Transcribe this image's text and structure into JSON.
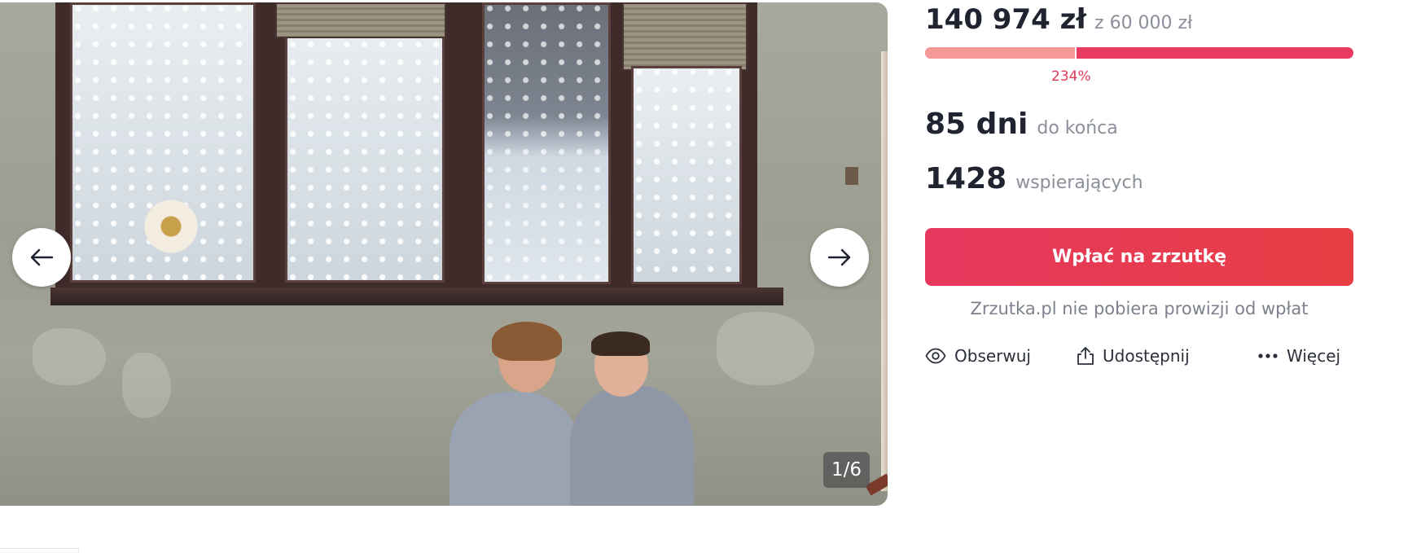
{
  "gallery": {
    "counter": "1/6",
    "prev_icon": "arrow-left-icon",
    "next_icon": "arrow-right-icon"
  },
  "fundraiser": {
    "raised": "140 974 zł",
    "goal": "z 60 000 zł",
    "progress_fraction": 0.35,
    "percent_label": "234%",
    "days_value": "85 dni",
    "days_label": "do końca",
    "supporters_value": "1428",
    "supporters_label": "wspierających",
    "cta_label": "Wpłać na zrzutkę",
    "note": "Zrzutka.pl nie pobiera prowizji od wpłat"
  },
  "actions": [
    {
      "label": "Obserwuj",
      "icon": "eye-icon"
    },
    {
      "label": "Udostępnij",
      "icon": "share-icon"
    },
    {
      "label": "Więcej",
      "icon": "more-dots-icon"
    }
  ],
  "colors": {
    "accent": "#e5395f",
    "progress_light": "#f59898",
    "text_dark": "#1f2430",
    "text_muted": "#8a8f99"
  }
}
